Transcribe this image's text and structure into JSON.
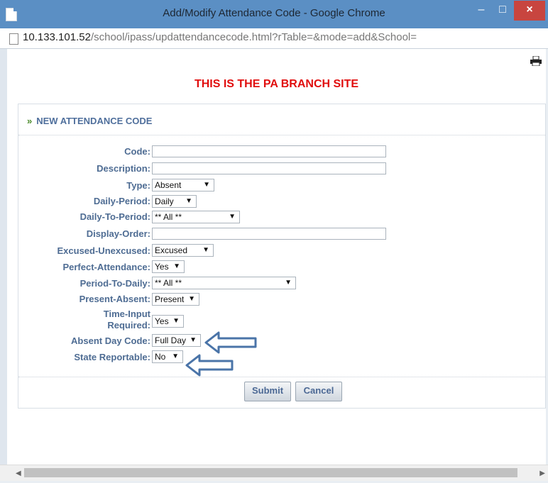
{
  "window": {
    "title": "Add/Modify Attendance Code - Google Chrome",
    "minimize": "‒",
    "maximize": "□",
    "close": "×"
  },
  "address": {
    "host": "10.133.101.52",
    "path": "/school/ipass/updattendancecode.html?rTable=&mode=add&School="
  },
  "page": {
    "banner": "THIS IS THE PA BRANCH SITE",
    "panel_title": "NEW ATTENDANCE CODE",
    "panel_title_icon": "»"
  },
  "form": {
    "code": {
      "label": "Code:",
      "value": ""
    },
    "description": {
      "label": "Description:",
      "value": ""
    },
    "type": {
      "label": "Type:",
      "value": "Absent"
    },
    "daily_period": {
      "label": "Daily-Period:",
      "value": "Daily"
    },
    "daily_to_period": {
      "label": "Daily-To-Period:",
      "value": "** All **"
    },
    "display_order": {
      "label": "Display-Order:",
      "value": ""
    },
    "excused_unexcused": {
      "label": "Excused-Unexcused:",
      "value": "Excused"
    },
    "perfect_attendance": {
      "label": "Perfect-Attendance:",
      "value": "Yes"
    },
    "period_to_daily": {
      "label": "Period-To-Daily:",
      "value": "** All **"
    },
    "present_absent": {
      "label": "Present-Absent:",
      "value": "Present"
    },
    "time_input_required": {
      "label_line1": "Time-Input",
      "label_line2": "Required:",
      "value": "Yes"
    },
    "absent_day_code": {
      "label": "Absent Day Code:",
      "value": "Full Day"
    },
    "state_reportable": {
      "label": "State Reportable:",
      "value": "No"
    }
  },
  "buttons": {
    "submit": "Submit",
    "cancel": "Cancel"
  },
  "icons": {
    "dropdown": "▼",
    "scroll_left": "◀",
    "scroll_right": "▶"
  },
  "colors": {
    "banner": "#e10d0d",
    "label": "#4e6c93",
    "annotation_arrow": "#4a74a8"
  }
}
